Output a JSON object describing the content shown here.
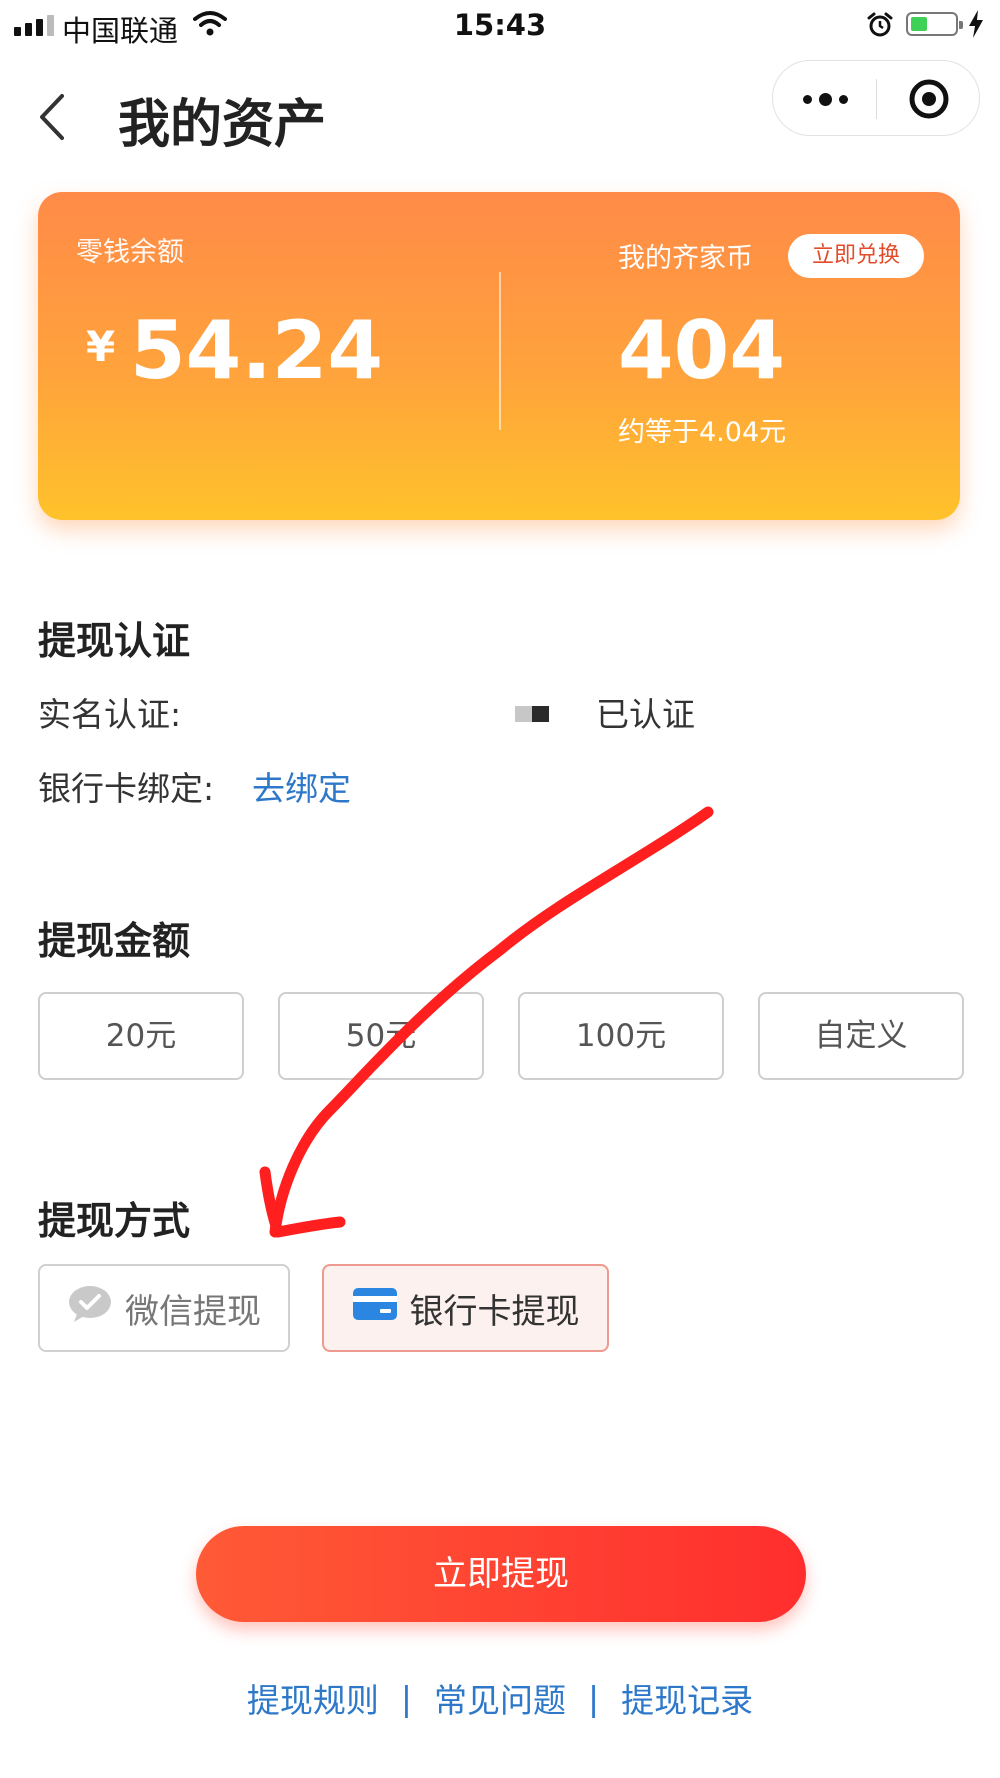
{
  "status_bar": {
    "carrier": "中国联通",
    "time": "15:43"
  },
  "nav": {
    "title": "我的资产"
  },
  "asset_card": {
    "balance_label": "零钱余额",
    "currency_symbol": "¥",
    "balance": "54.24",
    "coins_label": "我的齐家币",
    "exchange_button": "立即兑换",
    "coins": "404",
    "coins_approx": "约等于4.04元"
  },
  "verification": {
    "title": "提现认证",
    "realname_label": "实名认证:",
    "realname_status": "已认证",
    "bank_label": "银行卡绑定:",
    "bank_action": "去绑定"
  },
  "amount": {
    "title": "提现金额",
    "options": [
      "20元",
      "50元",
      "100元",
      "自定义"
    ]
  },
  "method": {
    "title": "提现方式",
    "wechat": "微信提现",
    "bank": "银行卡提现",
    "selected": "银行卡提现"
  },
  "submit_button": "立即提现",
  "footer_links": [
    "提现规则",
    "常见问题",
    "提现记录"
  ],
  "colors": {
    "link": "#2e78c9",
    "accent_red": "#ff3a2e",
    "card_gradient_start": "#ff8a48",
    "card_gradient_end": "#ffc22b",
    "annotation_arrow": "#ff1f1f"
  }
}
